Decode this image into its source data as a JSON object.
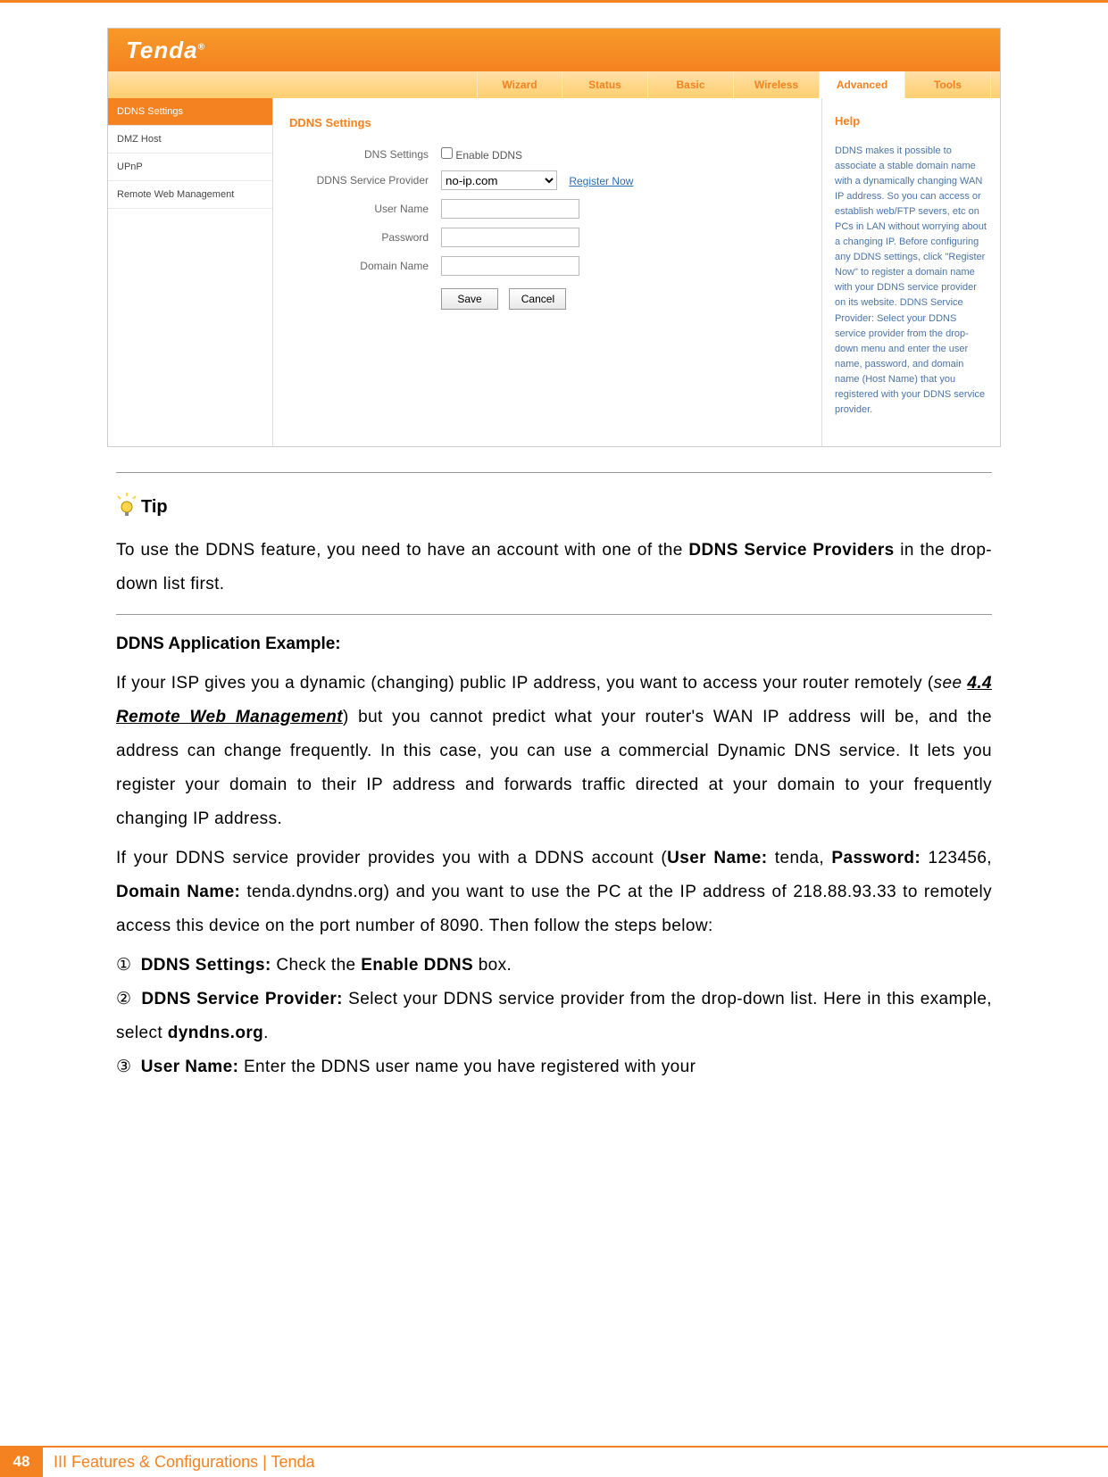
{
  "router": {
    "logo": "Tenda",
    "nav": {
      "items": [
        "Wizard",
        "Status",
        "Basic",
        "Wireless",
        "Advanced",
        "Tools"
      ],
      "active_index": 4
    },
    "sidebar": {
      "items": [
        "DDNS Settings",
        "DMZ Host",
        "UPnP",
        "Remote Web Management"
      ],
      "active_index": 0
    },
    "panel": {
      "title": "DDNS Settings",
      "labels": {
        "dns_settings": "DNS Settings",
        "enable_ddns": "Enable DDNS",
        "provider": "DDNS Service Provider",
        "username": "User Name",
        "password": "Password",
        "domain": "Domain Name"
      },
      "provider_value": "no-ip.com",
      "register_link": "Register Now",
      "save": "Save",
      "cancel": "Cancel"
    },
    "help": {
      "title": "Help",
      "text": "DDNS makes it possible to associate a stable domain name with a dynamically changing WAN IP address. So you can access or establish web/FTP severs, etc on PCs in LAN without worrying about a changing IP. Before configuring any DDNS settings, click \"Register Now\" to register a domain name with your DDNS service provider on its website. DDNS Service Provider: Select your DDNS service provider from the drop-down menu and enter the user name, password, and domain name (Host Name) that you registered with your DDNS service provider."
    }
  },
  "doc": {
    "tip_label": "Tip",
    "tip_text_a": "To use the DDNS feature, you need to have an account with one of the ",
    "tip_text_b": "DDNS Service Providers",
    "tip_text_c": " in the drop-down list first.",
    "example_heading": "DDNS Application Example:",
    "p1_a": "If your ISP gives you a dynamic (changing) public IP address, you want to access your router remotely (",
    "p1_see": "see ",
    "p1_link": "4.4 Remote Web Management",
    "p1_b": ") but you cannot predict what your router's WAN IP address will be, and the address can change frequently. In this case, you can use a commercial Dynamic DNS service. It lets you register your domain to their IP address and forwards traffic directed at your domain to your frequently changing IP address.",
    "p2_a": "If your DDNS service provider provides you with a DDNS account (",
    "p2_user_lbl": "User Name:",
    "p2_user_val": " tenda, ",
    "p2_pass_lbl": "Password:",
    "p2_pass_val": " 123456, ",
    "p2_dom_lbl": "Domain Name:",
    "p2_dom_val": " tenda.dyndns.org) and you want to use the PC at the IP address of 218.88.93.33 to remotely access this device on the port number of 8090. Then follow the steps below:",
    "steps": {
      "n1": "①",
      "n2": "②",
      "n3": "③",
      "s1_a": "DDNS Settings:",
      "s1_b": " Check the ",
      "s1_c": "Enable DDNS",
      "s1_d": " box.",
      "s2_a": "DDNS Service Provider:",
      "s2_b": " Select your DDNS service provider from the drop-down list. Here in this example, select ",
      "s2_c": "dyndns.org",
      "s2_d": ".",
      "s3_a": "User Name:",
      "s3_b": " Enter the DDNS user name you have registered with your"
    }
  },
  "footer": {
    "page": "48",
    "text": "III Features & Configurations | Tenda"
  }
}
